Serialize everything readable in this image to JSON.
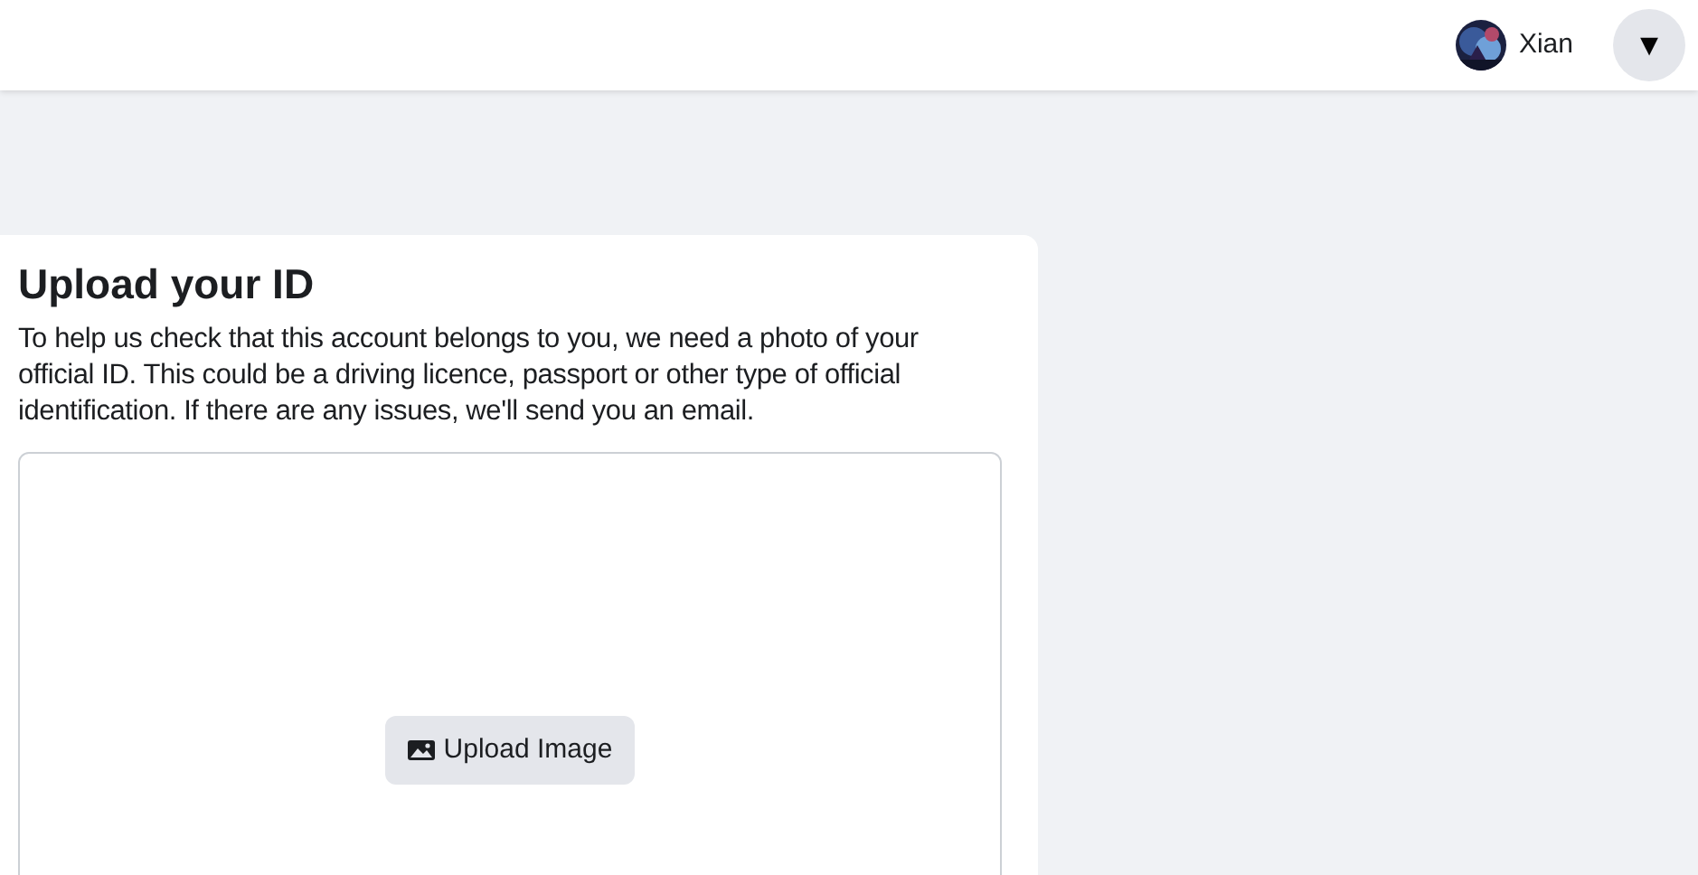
{
  "header": {
    "user_name": "Xian",
    "menu_button": "▾"
  },
  "card": {
    "title": "Upload your ID",
    "description": "To help us check that this account belongs to you, we need a photo of your official ID. This could be a driving licence, passport or other type of official identification. If there are any issues, we'll send you an email.",
    "upload_button": "Upload Image"
  }
}
